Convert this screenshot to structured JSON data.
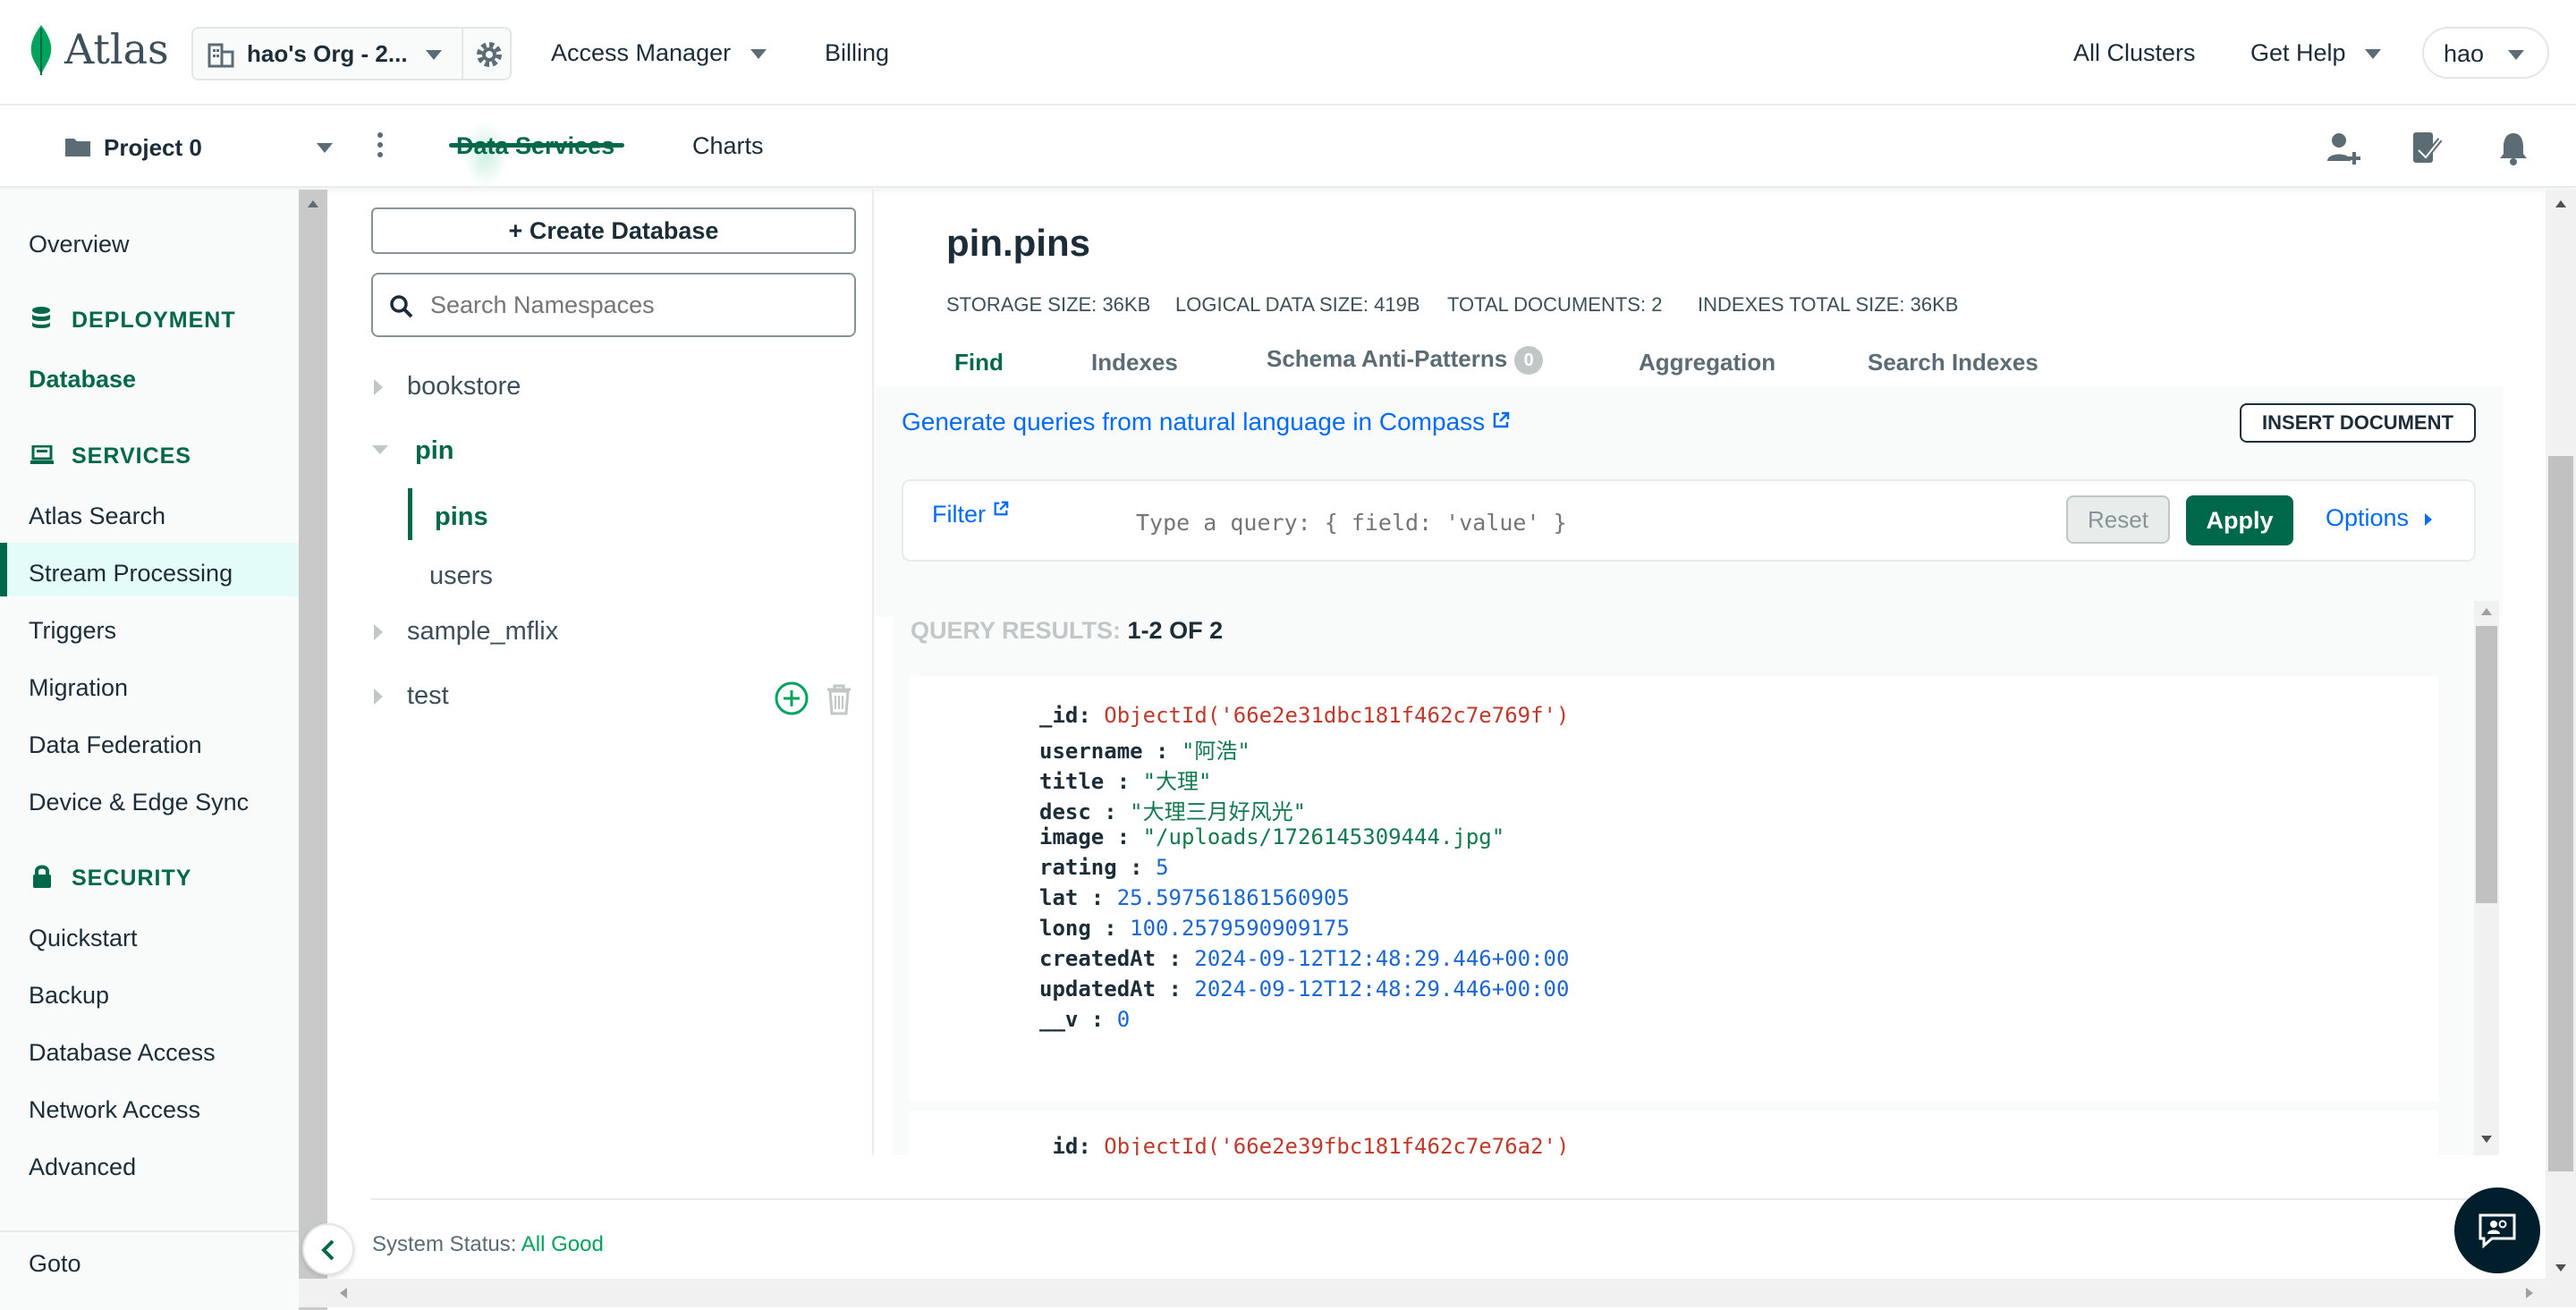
{
  "topbar": {
    "brand": "Atlas",
    "org_name": "hao's Org - 2...",
    "nav": [
      {
        "label": "Access Manager"
      },
      {
        "label": "Billing"
      }
    ],
    "right": {
      "all_clusters": "All Clusters",
      "get_help": "Get Help",
      "user": "hao"
    }
  },
  "projectbar": {
    "project": "Project 0",
    "tabs": [
      {
        "label": "Data Services",
        "active": true
      },
      {
        "label": "Charts",
        "active": false
      }
    ]
  },
  "sidebar": {
    "overview": "Overview",
    "sections": [
      {
        "heading": "DEPLOYMENT",
        "icon": "database-stack-icon",
        "items": [
          "Database"
        ]
      },
      {
        "heading": "SERVICES",
        "icon": "laptop-icon",
        "items": [
          "Atlas Search",
          "Stream Processing",
          "Triggers",
          "Migration",
          "Data Federation",
          "Device & Edge Sync"
        ]
      },
      {
        "heading": "SECURITY",
        "icon": "lock-icon",
        "items": [
          "Quickstart",
          "Backup",
          "Database Access",
          "Network Access",
          "Advanced"
        ]
      }
    ],
    "active_item": "Database",
    "goto": "Goto"
  },
  "namespaces": {
    "create_button": "+ Create Database",
    "search_placeholder": "Search Namespaces",
    "databases": [
      {
        "name": "bookstore",
        "expanded": false
      },
      {
        "name": "pin",
        "expanded": true,
        "collections": [
          {
            "name": "pins",
            "active": true
          },
          {
            "name": "users",
            "active": false
          }
        ]
      },
      {
        "name": "sample_mflix",
        "expanded": false
      },
      {
        "name": "test",
        "expanded": false
      }
    ]
  },
  "collection": {
    "title": "pin.pins",
    "stats": {
      "storage_label": "STORAGE SIZE:",
      "storage_value": "36KB",
      "logical_label": "LOGICAL DATA SIZE:",
      "logical_value": "419B",
      "docs_label": "TOTAL DOCUMENTS:",
      "docs_value": "2",
      "indexes_label": "INDEXES TOTAL SIZE:",
      "indexes_value": "36KB"
    },
    "tabs": [
      {
        "label": "Find",
        "active": true
      },
      {
        "label": "Indexes"
      },
      {
        "label": "Schema Anti-Patterns",
        "badge": "0"
      },
      {
        "label": "Aggregation"
      },
      {
        "label": "Search Indexes"
      }
    ],
    "compass_link": "Generate queries from natural language in Compass",
    "insert_button": "INSERT DOCUMENT",
    "filter": {
      "label": "Filter",
      "placeholder": "Type a query: { field: 'value' }",
      "reset": "Reset",
      "apply": "Apply",
      "options": "Options"
    },
    "results": {
      "label": "QUERY RESULTS:",
      "count": "1-2 OF 2",
      "documents": [
        {
          "fields": [
            {
              "key": "_id",
              "sep": ":",
              "value": "ObjectId('66e2e31dbc181f462c7e769f')",
              "type": "oid"
            },
            {
              "key": "username",
              "sep": " :",
              "value": "\"阿浩\"",
              "type": "str"
            },
            {
              "key": "title",
              "sep": " :",
              "value": "\"大理\"",
              "type": "str"
            },
            {
              "key": "desc",
              "sep": " :",
              "value": "\"大理三月好风光\"",
              "type": "str"
            },
            {
              "key": "image",
              "sep": " :",
              "value": "\"/uploads/1726145309444.jpg\"",
              "type": "str"
            },
            {
              "key": "rating",
              "sep": " :",
              "value": "5",
              "type": "num"
            },
            {
              "key": "lat",
              "sep": " :",
              "value": "25.597561861560905",
              "type": "num"
            },
            {
              "key": "long",
              "sep": " :",
              "value": "100.2579590909175",
              "type": "num"
            },
            {
              "key": "createdAt",
              "sep": " :",
              "value": "2024-09-12T12:48:29.446+00:00",
              "type": "num"
            },
            {
              "key": "updatedAt",
              "sep": " :",
              "value": "2024-09-12T12:48:29.446+00:00",
              "type": "num"
            },
            {
              "key": "__v",
              "sep": " :",
              "value": "0",
              "type": "num"
            }
          ]
        },
        {
          "fields": [
            {
              "key": "_id",
              "sep": ":",
              "value": "ObjectId('66e2e39fbc181f462c7e76a2')",
              "type": "oid"
            }
          ]
        }
      ]
    }
  },
  "footer": {
    "status_label": "System Status:",
    "status_value": "All Good"
  },
  "colors": {
    "brand_green": "#00684a",
    "link_blue": "#016bf8",
    "active_bg": "#e3fcf7"
  }
}
